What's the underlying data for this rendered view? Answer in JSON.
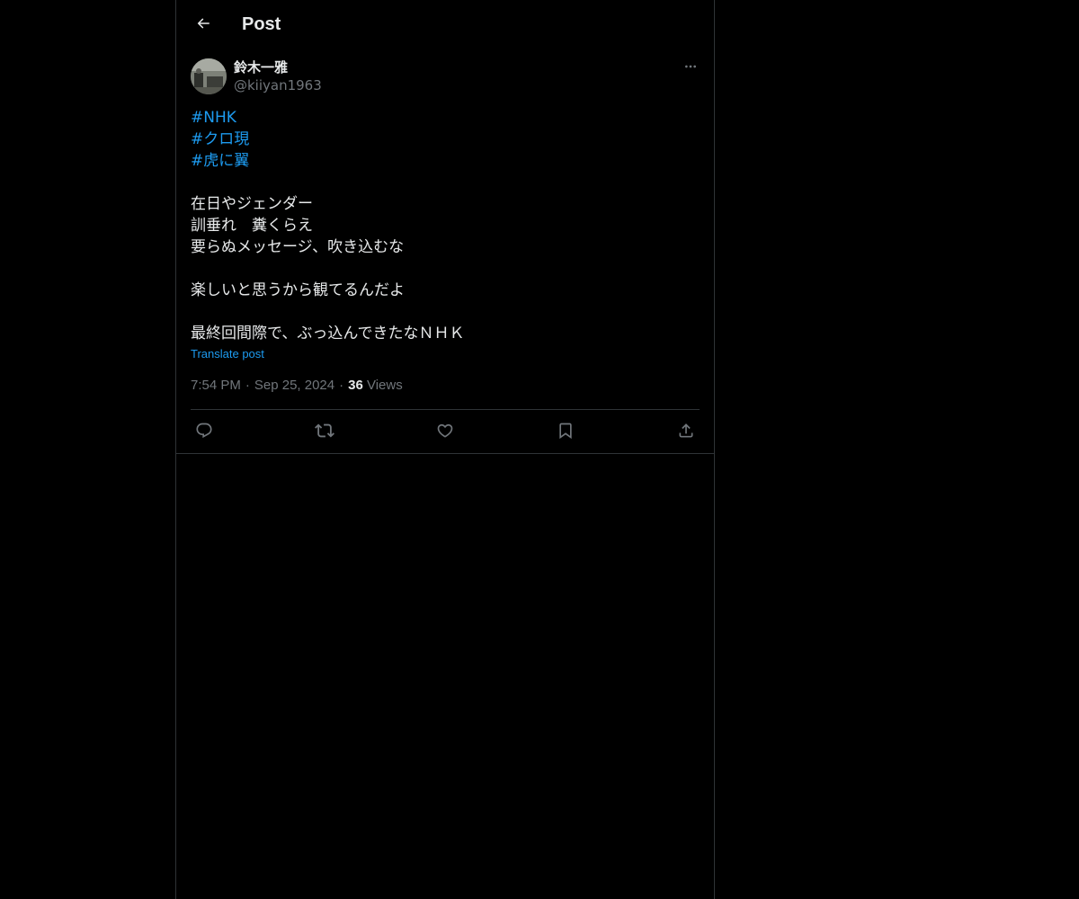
{
  "header": {
    "title": "Post",
    "back_icon": "arrow-left-icon"
  },
  "post": {
    "author": {
      "display_name": "鈴木一雅",
      "handle": "@kiiyan1963"
    },
    "hashtags": [
      "#NHK",
      "#クロ現",
      "#虎に翼"
    ],
    "body_lines": [
      "",
      "在日やジェンダー",
      "訓垂れ　糞くらえ",
      "要らぬメッセージ、吹き込むな",
      "",
      "楽しいと思うから観てるんだよ",
      "",
      "最終回間際で、ぶっ込んできたなＮＨＫ"
    ],
    "translate_label": "Translate post",
    "time": "7:54 PM",
    "date": "Sep 25, 2024",
    "views_count": "36",
    "views_label": "Views",
    "separator": "·"
  },
  "actions": [
    {
      "name": "reply-icon"
    },
    {
      "name": "retweet-icon"
    },
    {
      "name": "like-icon"
    },
    {
      "name": "bookmark-icon"
    },
    {
      "name": "share-icon"
    }
  ],
  "colors": {
    "background": "#000000",
    "text": "#e7e9ea",
    "secondary": "#71767b",
    "accent": "#1d9bf0",
    "border": "#2f3336"
  }
}
